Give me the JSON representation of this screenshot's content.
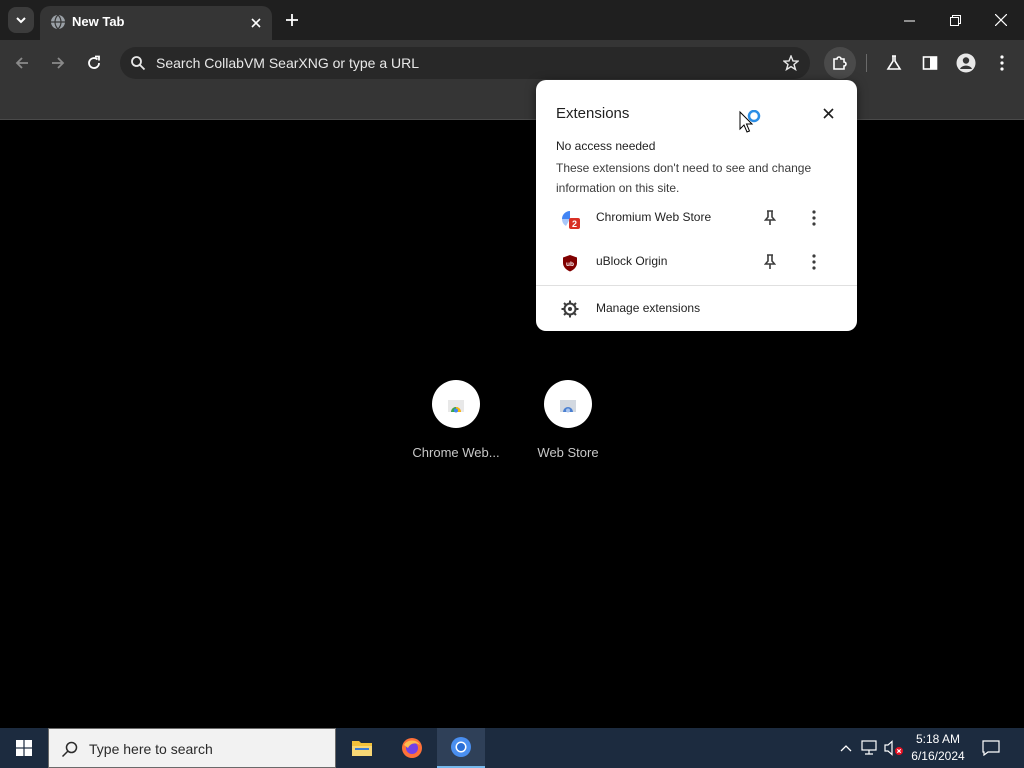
{
  "browser": {
    "tab": {
      "title": "New Tab"
    },
    "omnibox": {
      "placeholder": "Search CollabVM SearXNG or type a URL"
    }
  },
  "tiles": [
    {
      "label": "Chrome Web..."
    },
    {
      "label": "Web Store"
    }
  ],
  "extensions_popup": {
    "title": "Extensions",
    "section_heading": "No access needed",
    "section_description": "These extensions don't need to see and change information on this site.",
    "items": [
      {
        "name": "Chromium Web Store",
        "badge": "2"
      },
      {
        "name": "uBlock Origin",
        "icon_text": "ub"
      }
    ],
    "manage_label": "Manage extensions"
  },
  "taskbar": {
    "search_placeholder": "Type here to search",
    "time": "5:18 AM",
    "date": "6/16/2024"
  },
  "colors": {
    "taskbar_bg": "#1c2b3f",
    "toolbar_bg": "#353535",
    "popup_bg": "#ffffff",
    "ublock_red": "#800000",
    "badge_red": "#d93025"
  }
}
